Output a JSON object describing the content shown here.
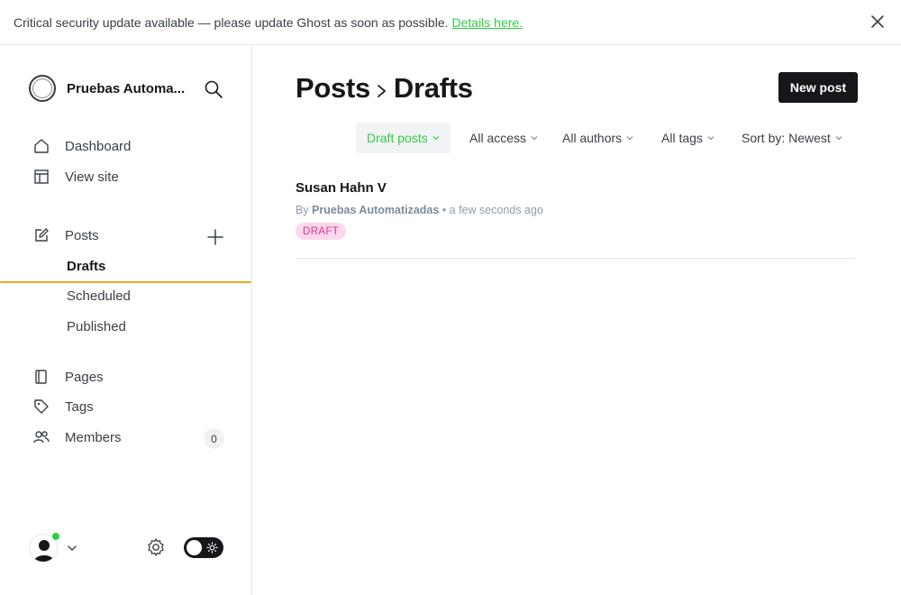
{
  "banner": {
    "message": "Critical security update available — please update Ghost as soon as possible.",
    "link_text": "Details here."
  },
  "sidebar": {
    "site_name": "Pruebas Automa...",
    "nav": {
      "dashboard": "Dashboard",
      "view_site": "View site",
      "posts": "Posts",
      "drafts": "Drafts",
      "scheduled": "Scheduled",
      "published": "Published",
      "pages": "Pages",
      "tags": "Tags",
      "members": "Members",
      "members_count": "0"
    }
  },
  "main": {
    "breadcrumb": [
      "Posts",
      "Drafts"
    ],
    "new_post_label": "New post",
    "filters": {
      "type": "Draft posts",
      "access": "All access",
      "authors": "All authors",
      "tags": "All tags",
      "sort": "Sort by: Newest"
    },
    "posts": [
      {
        "title": "Susan Hahn V",
        "by": "By",
        "author": "Pruebas Automatizadas",
        "time": "• a few seconds ago",
        "status": "DRAFT"
      }
    ]
  },
  "colors": {
    "accent_green": "#30cf43",
    "active_bar": "#f3a31c",
    "draft_badge_bg": "#fcd8ec",
    "draft_badge_text": "#e7368b"
  }
}
